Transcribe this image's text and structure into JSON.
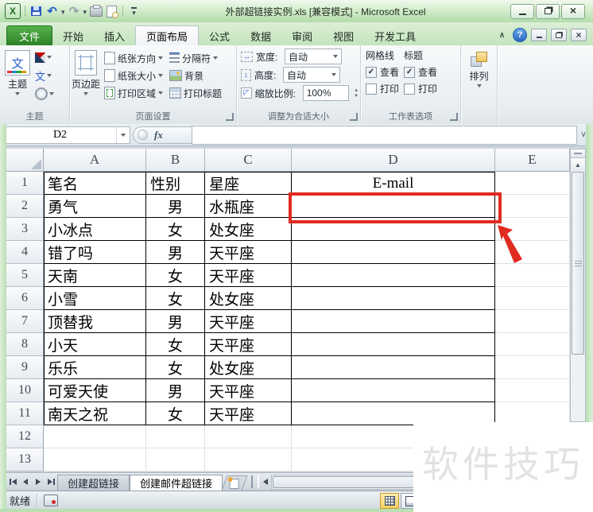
{
  "window": {
    "title": "外部超链接实例.xls  [兼容模式]  -  Microsoft Excel"
  },
  "ribbon_tabs": {
    "file": "文件",
    "home": "开始",
    "insert": "插入",
    "page_layout": "页面布局",
    "formulas": "公式",
    "data": "数据",
    "review": "审阅",
    "view": "视图",
    "developer": "开发工具",
    "active": "页面布局"
  },
  "ribbon": {
    "themes": {
      "group": "主题",
      "themes_btn": "主题"
    },
    "page_setup": {
      "group": "页面设置",
      "margins": "页边距",
      "orientation": "纸张方向",
      "paper_size": "纸张大小",
      "print_area": "打印区域",
      "breaks": "分隔符",
      "background": "背景",
      "print_titles": "打印标题"
    },
    "scale_fit": {
      "group": "调整为合适大小",
      "width_label": "宽度:",
      "width_value": "自动",
      "height_label": "高度:",
      "height_value": "自动",
      "scale_label": "缩放比例:",
      "scale_value": "100%"
    },
    "sheet_options": {
      "group": "工作表选项",
      "gridlines": "网格线",
      "headings": "标题",
      "gridlines_view": "查看",
      "gridlines_print": "打印",
      "headings_view": "查看",
      "headings_print": "打印",
      "gridlines_view_checked": true,
      "gridlines_print_checked": false,
      "headings_view_checked": true,
      "headings_print_checked": false
    },
    "arrange": {
      "group": "排列",
      "arrange_btn": "排列"
    }
  },
  "formula_bar": {
    "name_box": "D2",
    "formula_value": ""
  },
  "grid": {
    "columns": [
      "A",
      "B",
      "C",
      "D",
      "E"
    ],
    "rows": [
      {
        "n": "1",
        "a": "笔名",
        "b": "性别",
        "c": "星座",
        "d": "E-mail"
      },
      {
        "n": "2",
        "a": "勇气",
        "b": "男",
        "c": "水瓶座",
        "d": ""
      },
      {
        "n": "3",
        "a": "小冰点",
        "b": "女",
        "c": "处女座",
        "d": ""
      },
      {
        "n": "4",
        "a": "错了吗",
        "b": "男",
        "c": "天平座",
        "d": ""
      },
      {
        "n": "5",
        "a": "天南",
        "b": "女",
        "c": "天平座",
        "d": ""
      },
      {
        "n": "6",
        "a": "小雪",
        "b": "女",
        "c": "处女座",
        "d": ""
      },
      {
        "n": "7",
        "a": "顶替我",
        "b": "男",
        "c": "天平座",
        "d": ""
      },
      {
        "n": "8",
        "a": "小天",
        "b": "女",
        "c": "天平座",
        "d": ""
      },
      {
        "n": "9",
        "a": "乐乐",
        "b": "女",
        "c": "处女座",
        "d": ""
      },
      {
        "n": "10",
        "a": "可爱天使",
        "b": "男",
        "c": "天平座",
        "d": ""
      },
      {
        "n": "11",
        "a": "南天之祝",
        "b": "女",
        "c": "天平座",
        "d": ""
      },
      {
        "n": "12",
        "a": "",
        "b": "",
        "c": "",
        "d": ""
      },
      {
        "n": "13",
        "a": "",
        "b": "",
        "c": "",
        "d": ""
      }
    ],
    "selected_cell": "D2"
  },
  "sheet_bar": {
    "tab1": "创建超链接",
    "tab2": "创建邮件超链接",
    "active": "创建邮件超链接"
  },
  "status_bar": {
    "ready": "就绪"
  },
  "watermark": "软件技巧",
  "annotation": {
    "target": "D2",
    "color": "#e02b20"
  }
}
